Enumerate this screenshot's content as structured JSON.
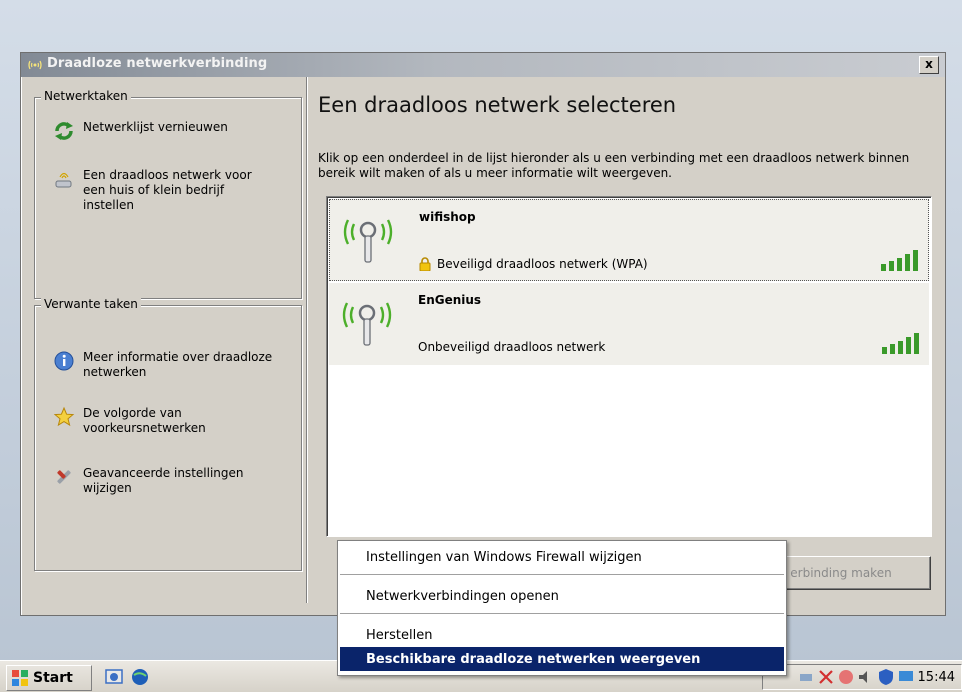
{
  "window": {
    "title": "Draadloze netwerkverbinding",
    "close_label": "x"
  },
  "left": {
    "network_tasks": {
      "label": "Netwerktaken",
      "items": [
        {
          "label": "Netwerklijst vernieuwen",
          "icon": "refresh-icon"
        },
        {
          "label": "Een draadloos netwerk voor een huis of klein bedrijf instellen",
          "icon": "wireless-setup-icon"
        }
      ]
    },
    "related_tasks": {
      "label": "Verwante taken",
      "items": [
        {
          "label": "Meer informatie over draadloze netwerken",
          "icon": "info-icon"
        },
        {
          "label": "De volgorde van voorkeursnetwerken",
          "icon": "star-icon"
        },
        {
          "label": "Geavanceerde instellingen wijzigen",
          "icon": "tools-icon"
        }
      ]
    }
  },
  "main": {
    "heading": "Een draadloos netwerk selecteren",
    "intro": "Klik op een onderdeel in de lijst hieronder als u een verbinding met een draadloos netwerk binnen bereik wilt maken of als u meer informatie wilt weergeven.",
    "networks": [
      {
        "ssid": "wifishop",
        "security": "Beveiligd draadloos netwerk (WPA)",
        "secured": true,
        "signal_bars": 5
      },
      {
        "ssid": "EnGenius",
        "security": "Onbeveiligd draadloos netwerk",
        "secured": false,
        "signal_bars": 5
      }
    ],
    "connect_button": "erbinding maken"
  },
  "context_menu": {
    "items": [
      "Instellingen van Windows Firewall wijzigen",
      "Netwerkverbindingen openen",
      "Herstellen",
      "Beschikbare draadloze netwerken weergeven"
    ],
    "highlighted_index": 3
  },
  "taskbar": {
    "start_label": "Start",
    "clock": "15:44"
  },
  "colors": {
    "menu_highlight": "#0a246a",
    "signal_green": "#3a9a2a",
    "window_bg": "#d4d0c8"
  }
}
